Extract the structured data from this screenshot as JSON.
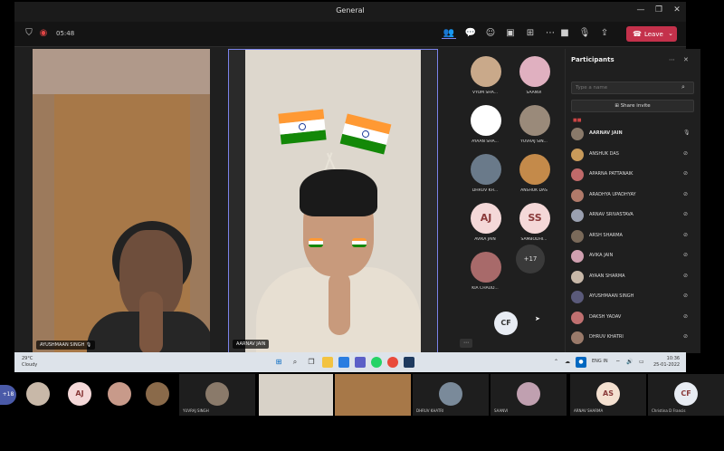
{
  "window": {
    "title": "General"
  },
  "toolbar": {
    "timer": "05:48",
    "leave_label": "Leave"
  },
  "main": {
    "tile1_name": "AYUSHMAAN SINGH",
    "tile2_name": "AARNAV JAIN"
  },
  "gallery": {
    "tiles": [
      {
        "label": "VYOM SHA...",
        "initials": ""
      },
      {
        "label": "SAANVI",
        "initials": ""
      },
      {
        "label": "AYAAN SHA...",
        "initials": ""
      },
      {
        "label": "YUVRAJ SIN...",
        "initials": ""
      },
      {
        "label": "DHRUV KH...",
        "initials": ""
      },
      {
        "label": "ANSHUK DAS",
        "initials": ""
      },
      {
        "label": "AVIKA JAIN",
        "initials": "AJ"
      },
      {
        "label": "SAMBODHI...",
        "initials": "SS"
      },
      {
        "label": "KIA CHAUD...",
        "initials": ""
      }
    ],
    "more_count": "+17",
    "self_initials": "CF"
  },
  "participants": {
    "header": "Participants",
    "search_placeholder": "Type a name",
    "share_invite": "Share invite",
    "list": [
      {
        "name": "AARNAV JAIN",
        "active": true
      },
      {
        "name": "ANSHUK DAS"
      },
      {
        "name": "APARNA PATTANAIK"
      },
      {
        "name": "ARADHYA UPADHYAY"
      },
      {
        "name": "ARNAV SRIVASTAVA"
      },
      {
        "name": "ARSH SHARMA"
      },
      {
        "name": "AVIKA JAIN"
      },
      {
        "name": "AYAAN SHARMA"
      },
      {
        "name": "AYUSHMAAN SINGH"
      },
      {
        "name": "DAKSH YADAV"
      },
      {
        "name": "DHRUV KHATRI"
      }
    ]
  },
  "taskbar": {
    "weather_temp": "29°C",
    "weather_desc": "Cloudy",
    "time": "10:36",
    "date": "25-01-2022",
    "lang": "ENG IN"
  },
  "strip": {
    "count": "+18",
    "tiles": [
      {
        "initials": "",
        "name": ""
      },
      {
        "initials": "AJ",
        "name": ""
      },
      {
        "initials": "",
        "name": ""
      },
      {
        "initials": "",
        "name": ""
      },
      {
        "initials": "",
        "name": "YUVRAJ SINGH"
      },
      {
        "initials": "",
        "name": "DHRUV KHATRI"
      },
      {
        "initials": "",
        "name": "SAANVI"
      },
      {
        "initials": "AS",
        "name": "ARNAV SHARMA"
      },
      {
        "initials": "CF",
        "name": "Christina D Francis"
      }
    ]
  },
  "colors": {
    "accent": "#7b83eb",
    "leave": "#c4314b"
  }
}
